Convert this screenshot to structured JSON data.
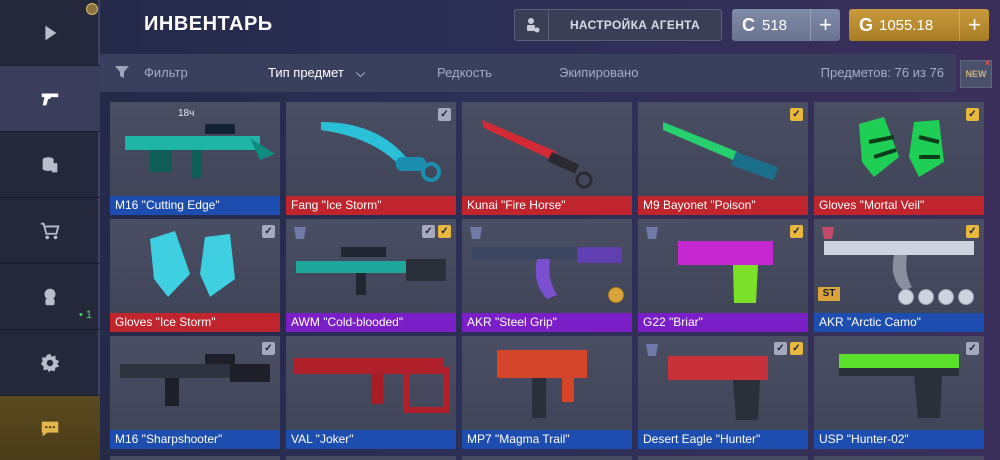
{
  "header": {
    "title": "ИНВЕНТАРЬ",
    "agent_button": "НАСТРОЙКА АГЕНТА"
  },
  "currency": {
    "silver": {
      "symbol": "C",
      "value": "518",
      "plus": "+"
    },
    "gold": {
      "symbol": "G",
      "value": "1055.18",
      "plus": "+"
    }
  },
  "sidebar": {
    "items": [
      {
        "icon": "play-icon"
      },
      {
        "icon": "pistol-icon",
        "active": true
      },
      {
        "icon": "coins-icon"
      },
      {
        "icon": "cart-icon"
      },
      {
        "icon": "agent-icon",
        "badge": "• 1"
      },
      {
        "icon": "gear-icon"
      },
      {
        "icon": "chat-icon"
      }
    ]
  },
  "filters": {
    "filter": "Фильтр",
    "type": "Тип предмет",
    "rarity": "Редкость",
    "equipped": "Экипировано",
    "count": "Предметов: 76 из 76",
    "new_badge": "NEW",
    "new_close": "×"
  },
  "items": [
    {
      "name": "M16 \"Cutting Edge\"",
      "rarity": "blue",
      "timer": "18ч"
    },
    {
      "name": "Fang \"Ice Storm\"",
      "rarity": "red"
    },
    {
      "name": "Kunai \"Fire Horse\"",
      "rarity": "red"
    },
    {
      "name": "M9 Bayonet \"Poison\"",
      "rarity": "red"
    },
    {
      "name": "Gloves \"Mortal Veil\"",
      "rarity": "red"
    },
    {
      "name": "Gloves \"Ice Storm\"",
      "rarity": "red"
    },
    {
      "name": "AWM \"Cold-blooded\"",
      "rarity": "purple"
    },
    {
      "name": "AKR \"Steel Grip\"",
      "rarity": "purple"
    },
    {
      "name": "G22 \"Briar\"",
      "rarity": "purple"
    },
    {
      "name": "AKR \"Arctic Camo\"",
      "rarity": "blue",
      "badge": "ST"
    },
    {
      "name": "M16 \"Sharpshooter\"",
      "rarity": "blue"
    },
    {
      "name": "VAL \"Joker\"",
      "rarity": "blue"
    },
    {
      "name": "MP7 \"Magma Trail\"",
      "rarity": "blue"
    },
    {
      "name": "Desert Eagle \"Hunter\"",
      "rarity": "blue"
    },
    {
      "name": "USP \"Hunter-02\"",
      "rarity": "blue"
    }
  ],
  "colors": {
    "rarity_blue": "#1e4db0",
    "rarity_red": "#c0242d",
    "rarity_purple": "#7a1fc7",
    "gold": "#c89a3c",
    "silver": "#7f8aa8"
  }
}
